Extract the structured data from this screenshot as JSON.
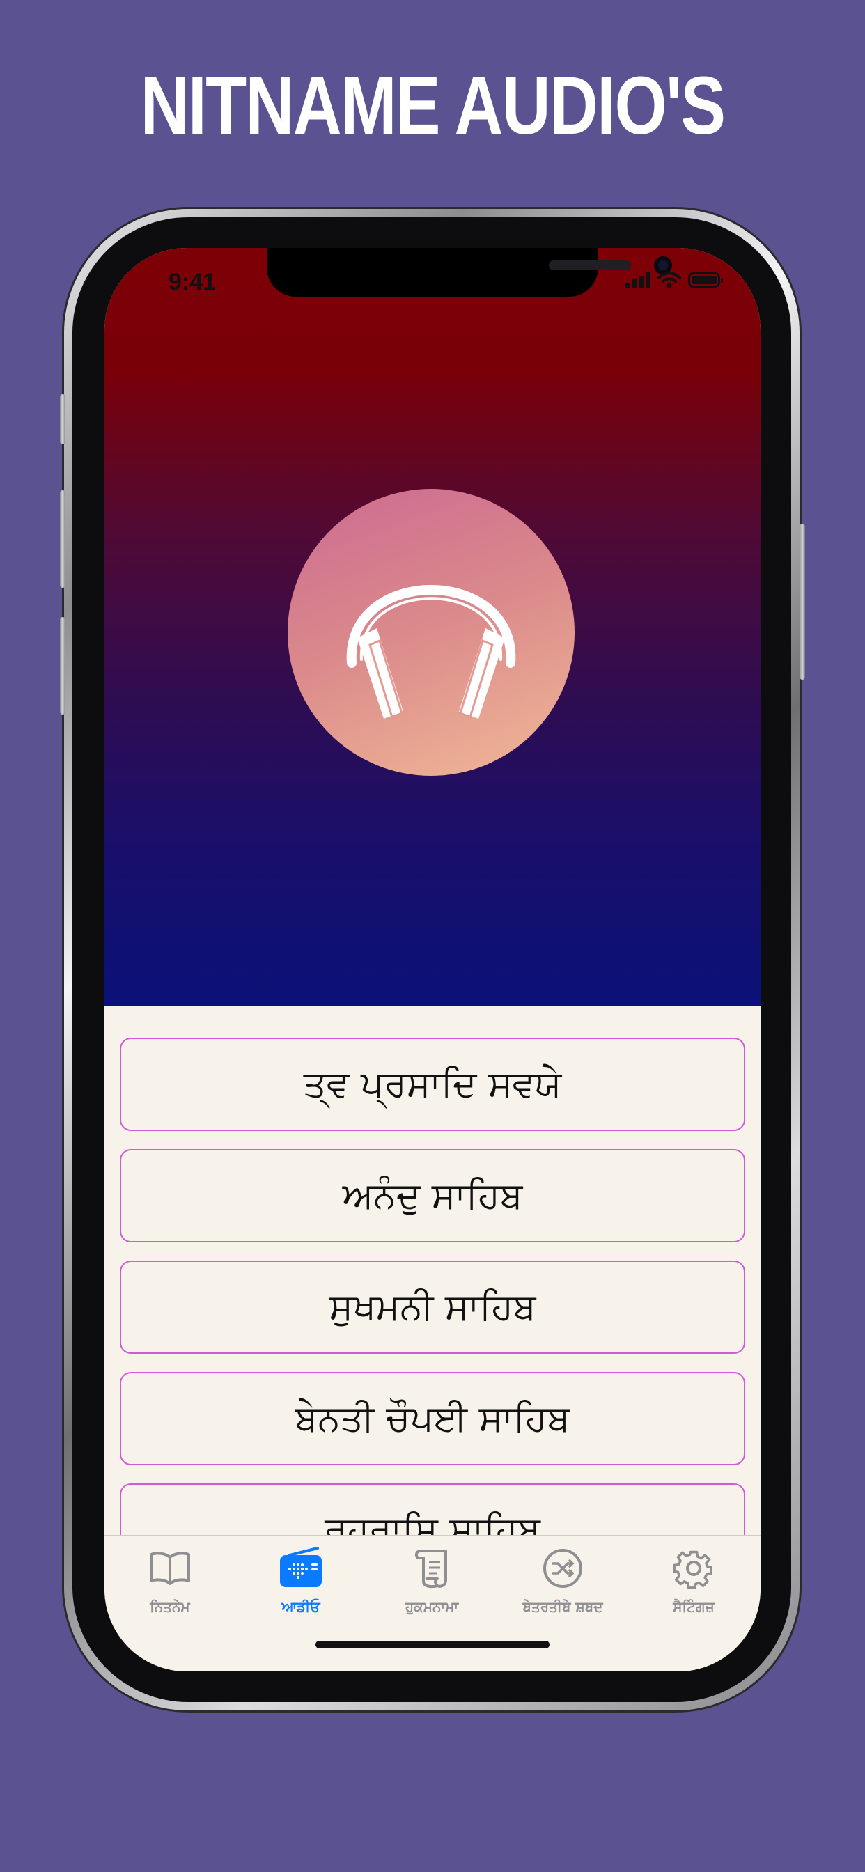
{
  "headline": "NITNAME AUDIO'S",
  "status_bar": {
    "time": "9:41"
  },
  "audio_list": [
    {
      "label": "ਤ੍ਵ ਪ੍ਰਸਾਦਿ ਸਵਯੇ"
    },
    {
      "label": "ਅਨੰਦੁ ਸਾਹਿਬ"
    },
    {
      "label": "ਸੁਖਮਨੀ ਸਾਹਿਬ"
    },
    {
      "label": "ਬੇਨਤੀ ਚੌਪਈ ਸਾਹਿਬ"
    },
    {
      "label": "ਰਹਰਾਸਿ ਸਾਹਿਬ"
    }
  ],
  "tabs": [
    {
      "label": "ਨਿਤਨੇਮ",
      "icon": "book-icon",
      "active": false
    },
    {
      "label": "ਆਡੀਓ",
      "icon": "radio-icon",
      "active": true
    },
    {
      "label": "ਹੁਕਮਨਾਮਾ",
      "icon": "scroll-icon",
      "active": false
    },
    {
      "label": "ਬੇਤਰਤੀਬੇ ਸ਼ਬਦ",
      "icon": "shuffle-icon",
      "active": false
    },
    {
      "label": "ਸੈਟਿੰਗਜ਼",
      "icon": "gear-icon",
      "active": false
    }
  ],
  "colors": {
    "background": "#5a5291",
    "hero_top": "#7c0006",
    "hero_bottom": "#0a1178",
    "item_border": "#d15ad8",
    "active_tab": "#0a7aff",
    "inactive_tab": "#8e8e93"
  }
}
